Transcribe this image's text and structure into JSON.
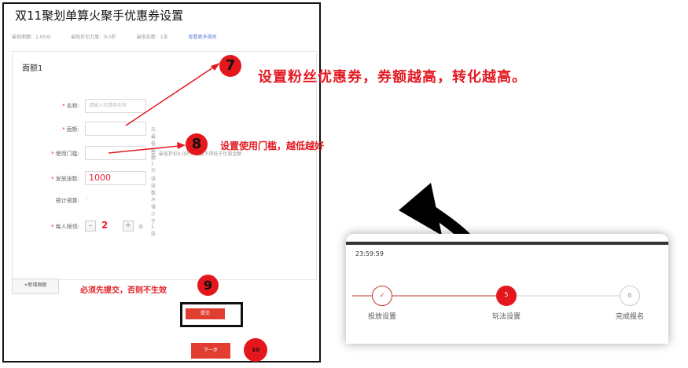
{
  "title": "双11聚划单算火聚手优惠券设置",
  "stats": {
    "min_amount": "最低面额：1.00元",
    "min_discount": "最低折扣力度：9.0折",
    "min_count": "最低张数：1张",
    "more_rules_link": "查看更多规则"
  },
  "form": {
    "section_title": "面额1",
    "name_label": "名称:",
    "name_placeholder": "请输入优惠券名称",
    "amount_label": "面额:",
    "amount_unit": "元",
    "amount_hint": "最低面额1元",
    "threshold_label": "使用门槛:",
    "threshold_unit": "元",
    "threshold_hint": "最低折扣9.0折，门槛不得低于优惠金额",
    "count_label": "发放张数:",
    "count_value": "1000",
    "count_unit": "张",
    "count_hint": "张数不得少于1张",
    "budget_label": "预计预算:",
    "budget_value": "–",
    "limit_label": "每人限领:",
    "limit_minus": "–",
    "limit_value": "2",
    "limit_plus": "+",
    "limit_unit": "张",
    "add_amount_button": "+新增面额",
    "submit_button": "提交",
    "next_button": "下一步"
  },
  "annotations": {
    "badge7": "7",
    "note7": "设置粉丝优惠券，券额越高，转化越高。",
    "badge8": "8",
    "note8": "设置使用门槛，越低越好",
    "badge9": "9",
    "note9": "必须先提交，否则不生效",
    "badge10": "10"
  },
  "phone": {
    "time": "23:59:59",
    "steps": [
      {
        "num": "✓",
        "label": "投放设置",
        "state": "done"
      },
      {
        "num": "5",
        "label": "玩法设置",
        "state": "active"
      },
      {
        "num": "6",
        "label": "完成报名",
        "state": "pending"
      }
    ]
  },
  "colors": {
    "accent_red": "#e31b23",
    "button_red": "#e13d30"
  }
}
